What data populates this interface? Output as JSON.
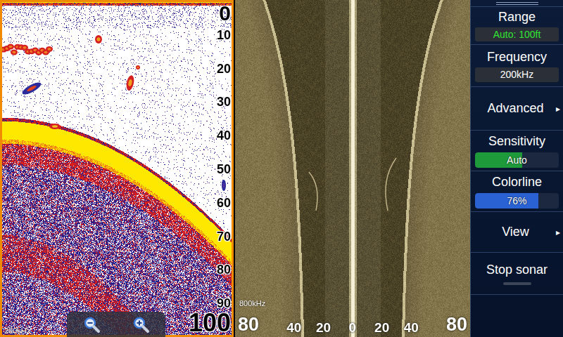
{
  "sonar": {
    "surface": "0",
    "ticks": [
      "10",
      "20",
      "30",
      "40",
      "50",
      "60",
      "70",
      "80",
      "90"
    ],
    "range": "100",
    "frequency": "200kHz"
  },
  "sidescan": {
    "frequency": "800kHz",
    "scale": [
      {
        "text": "80",
        "side": "left"
      },
      {
        "text": "40",
        "side": "left"
      },
      {
        "text": "20",
        "side": "left"
      },
      {
        "text": "0",
        "side": "center"
      },
      {
        "text": "20",
        "side": "right"
      },
      {
        "text": "40",
        "side": "right"
      },
      {
        "text": "80",
        "side": "right"
      }
    ]
  },
  "menu": {
    "items": [
      {
        "kind": "value",
        "label": "Range",
        "value": "Auto: 100ft",
        "color": "#33e533"
      },
      {
        "kind": "value",
        "label": "Frequency",
        "value": "200kHz",
        "color": "#ffffff"
      },
      {
        "kind": "submenu",
        "label": "Advanced",
        "arrow": "▸"
      },
      {
        "kind": "slider",
        "label": "Sensitivity",
        "value": "Auto",
        "level": 0.56,
        "color": "#1f9a3a"
      },
      {
        "kind": "slider",
        "label": "Colorline",
        "value": "76%",
        "level": 0.76,
        "color": "#2a62d4"
      },
      {
        "kind": "submenu",
        "label": "View",
        "arrow": "▸"
      },
      {
        "kind": "toggle",
        "label": "Stop sonar",
        "on": false
      }
    ]
  }
}
